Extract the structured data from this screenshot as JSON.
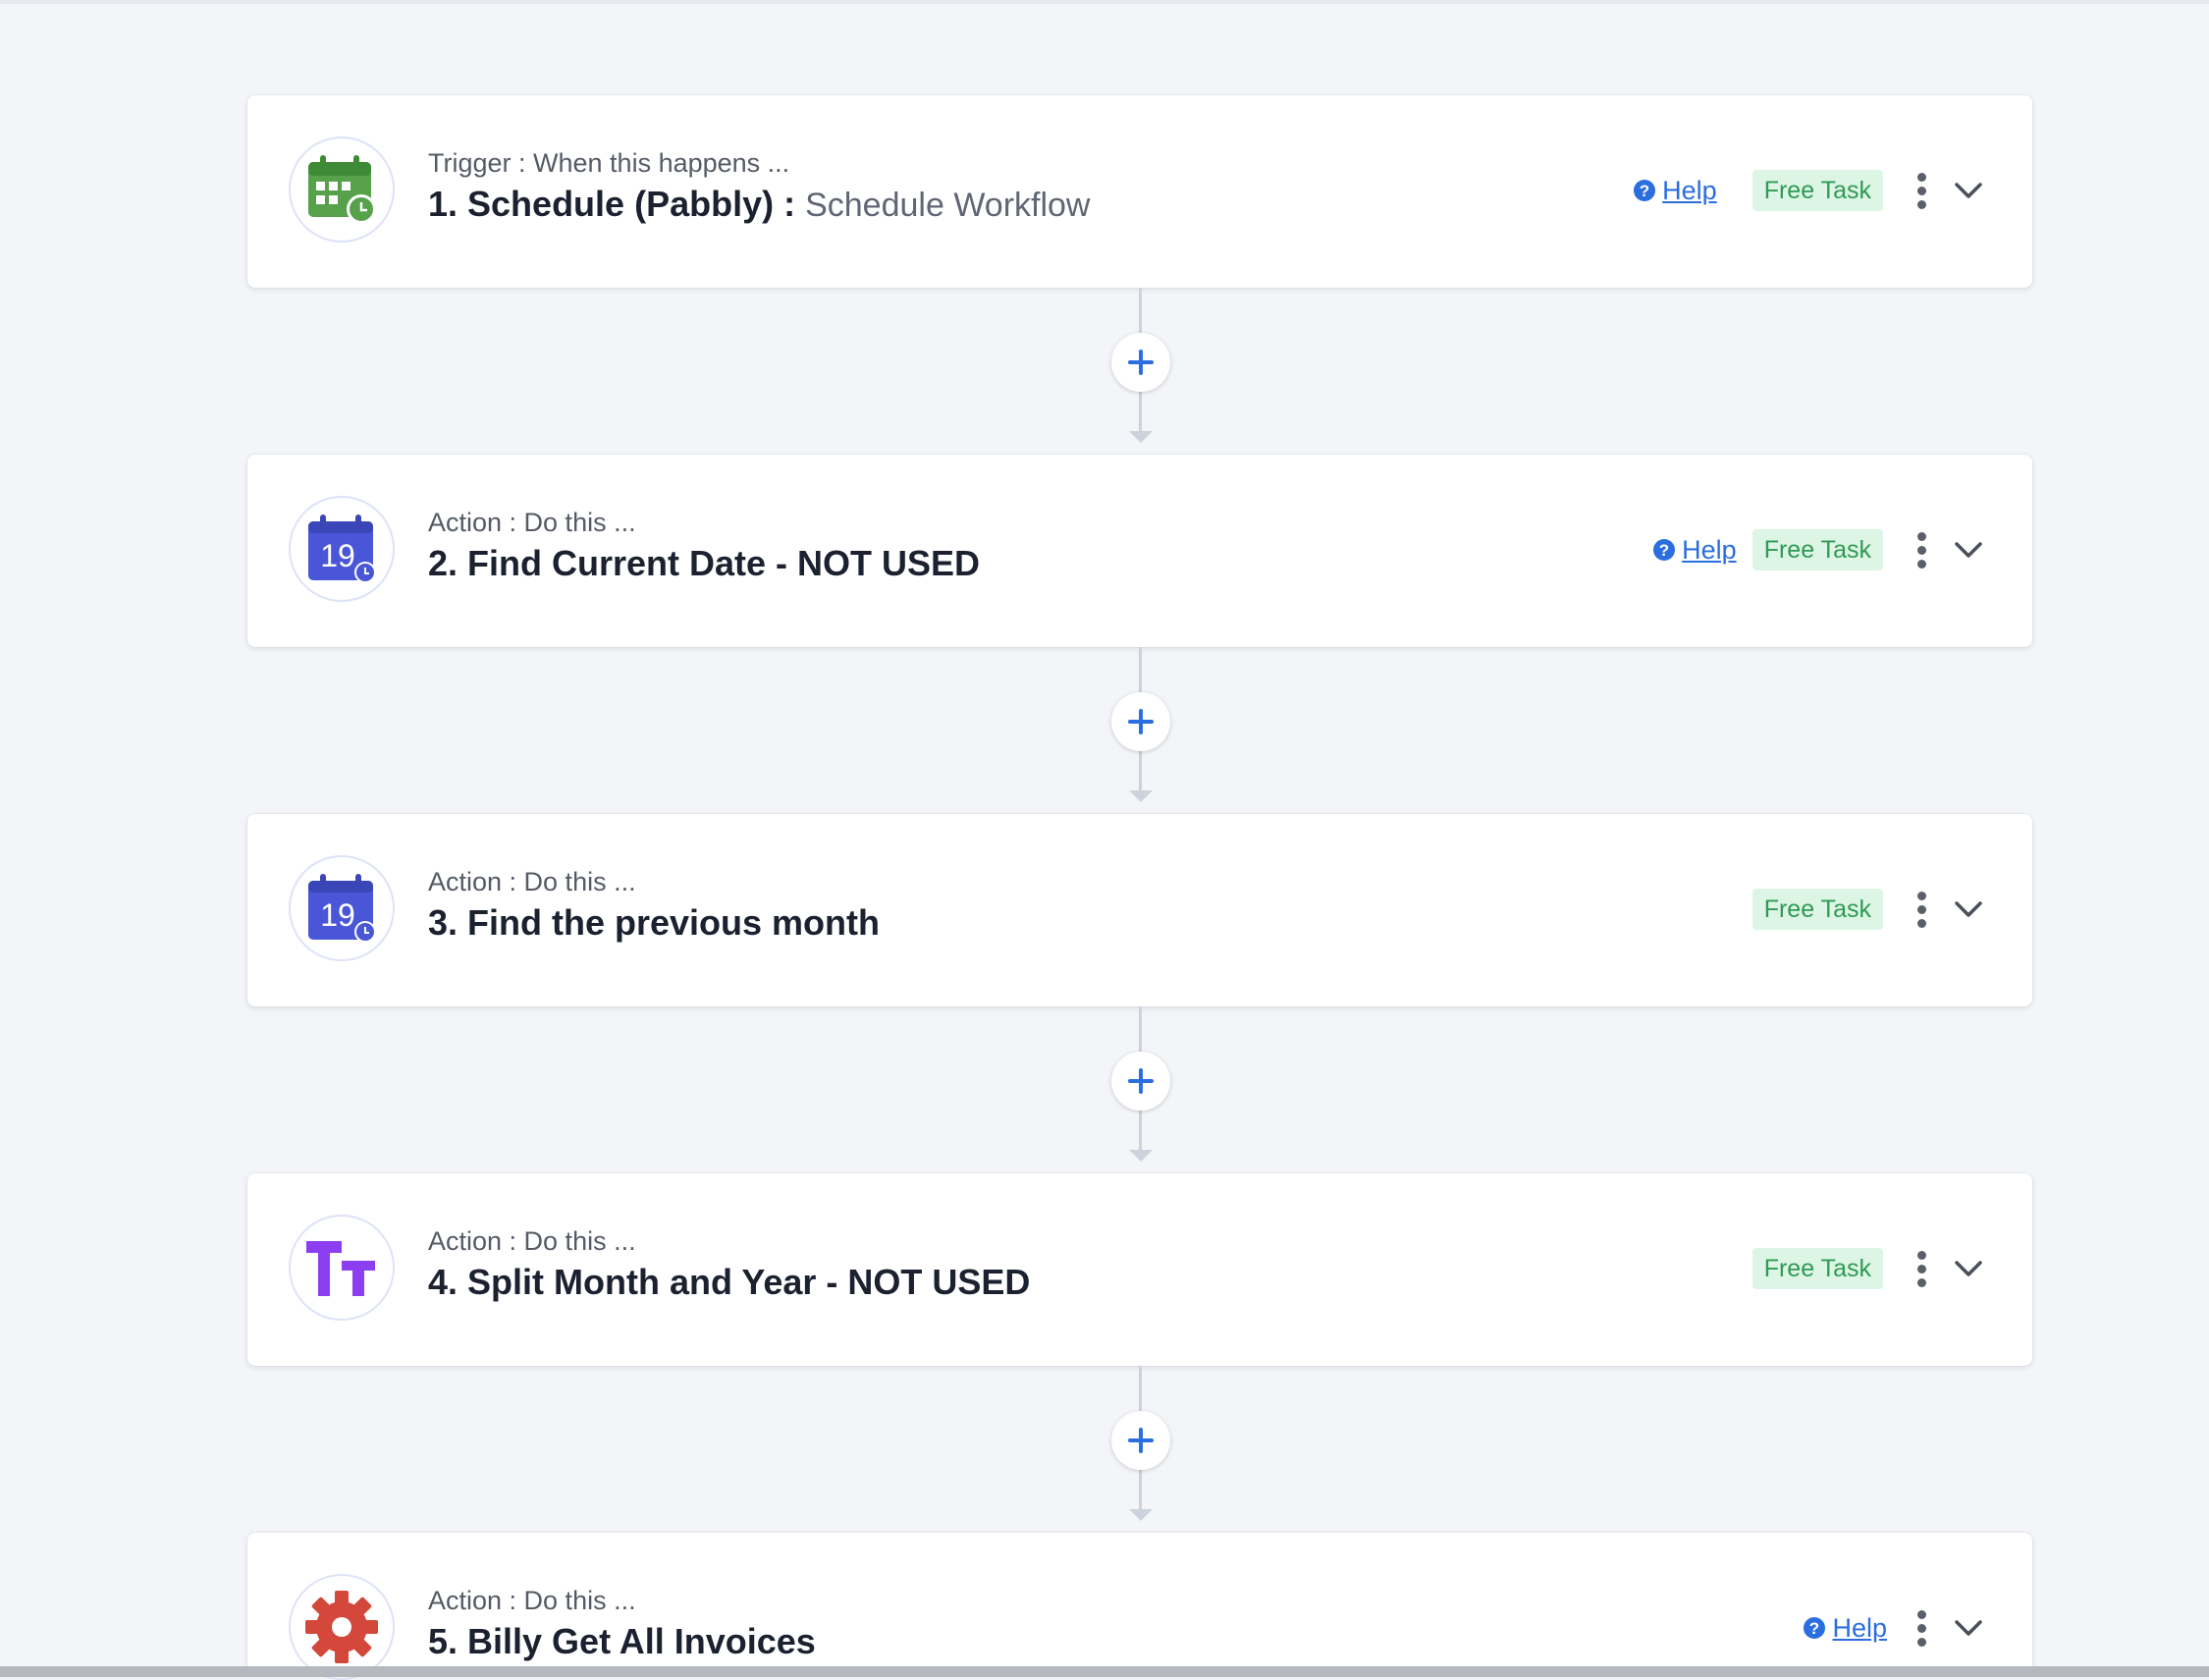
{
  "steps": [
    {
      "subtitle": "Trigger : When this happens ...",
      "title": "1. Schedule (Pabbly) : ",
      "event": "Schedule Workflow",
      "help": "Help",
      "badge": "Free Task",
      "icon": "schedule-calendar-icon"
    },
    {
      "subtitle": "Action : Do this ...",
      "title": "2. Find Current Date - NOT USED",
      "help": "Help",
      "badge": "Free Task",
      "icon": "date-calendar-19-icon",
      "calendar_day": "19"
    },
    {
      "subtitle": "Action : Do this ...",
      "title": "3. Find the previous month",
      "badge": "Free Task",
      "icon": "date-calendar-19-icon",
      "calendar_day": "19"
    },
    {
      "subtitle": "Action : Do this ...",
      "title": "4. Split Month and Year - NOT USED",
      "badge": "Free Task",
      "icon": "text-formatter-icon"
    },
    {
      "subtitle": "Action : Do this ...",
      "title": "5. Billy Get All Invoices",
      "help": "Help",
      "icon": "gear-icon"
    }
  ],
  "colors": {
    "accent": "#2a6ee0",
    "badge_bg": "#ddf5e4",
    "badge_text": "#2f9a55",
    "calendar_blue": "#4a56d8",
    "schedule_green": "#56a14a",
    "formatter_purple": "#8b3ff0",
    "gear_red": "#d4473b"
  }
}
